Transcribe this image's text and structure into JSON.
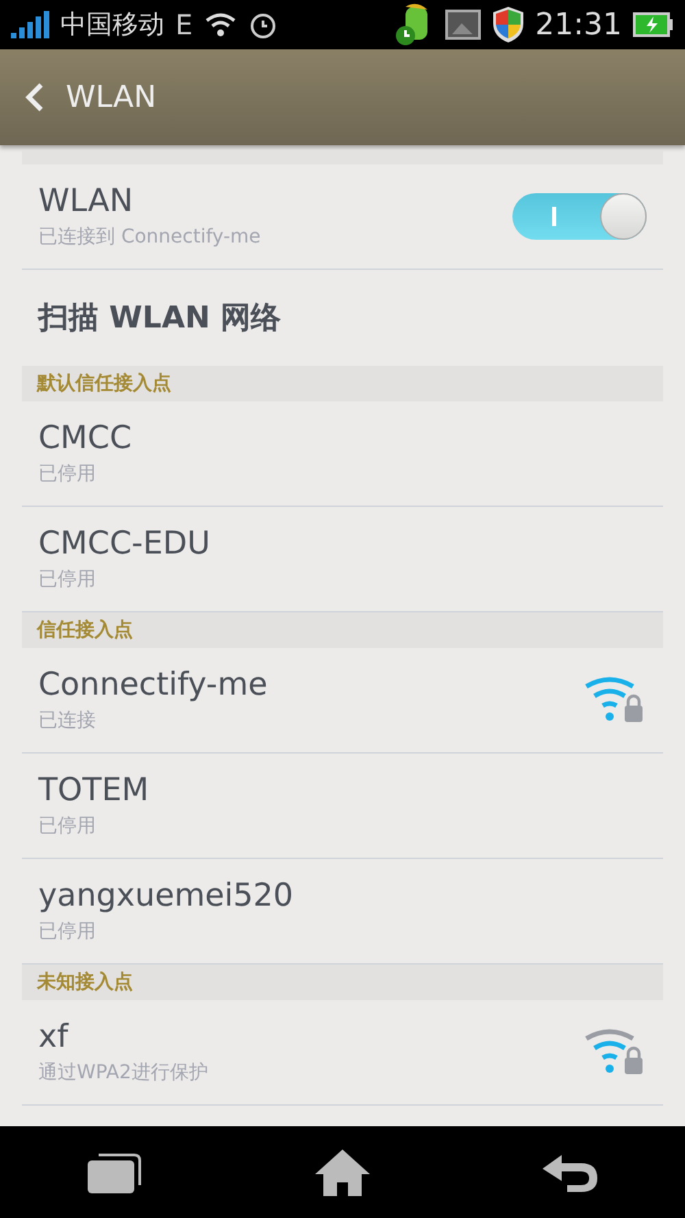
{
  "status_bar": {
    "carrier": "中国移动",
    "network": "E",
    "time": "21:31"
  },
  "header": {
    "title": "WLAN"
  },
  "wlan": {
    "title": "WLAN",
    "subtitle": "已连接到 Connectify-me",
    "on": true
  },
  "scan": {
    "label": "扫描 WLAN 网络"
  },
  "sections": [
    {
      "title": "默认信任接入点",
      "networks": [
        {
          "name": "CMCC",
          "status": "已停用"
        },
        {
          "name": "CMCC-EDU",
          "status": "已停用"
        }
      ]
    },
    {
      "title": "信任接入点",
      "networks": [
        {
          "name": "Connectify-me",
          "status": "已连接",
          "kind": "strong_signal"
        },
        {
          "name": "TOTEM",
          "status": "已停用"
        },
        {
          "name": "yangxuemei520",
          "status": "已停用"
        }
      ]
    },
    {
      "title": "未知接入点",
      "networks": [
        {
          "name": "xf",
          "status": "通过WPA2进行保护",
          "kind": "medium_signal"
        }
      ]
    }
  ]
}
